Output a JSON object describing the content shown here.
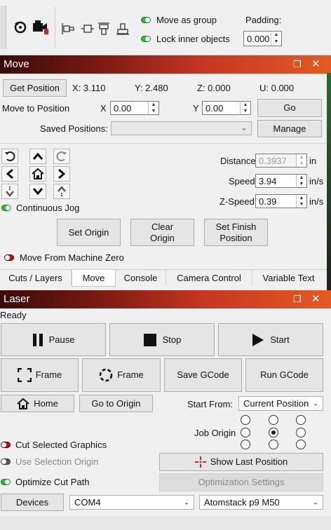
{
  "toolbar": {
    "move_as_group": "Move as group",
    "lock_inner_objects": "Lock inner objects",
    "padding_label": "Padding:",
    "padding_value": "0.000"
  },
  "move_panel": {
    "title": "Move",
    "get_position": "Get Position",
    "x_readout": "X: 3.110",
    "y_readout": "Y: 2.480",
    "z_readout": "Z: 0.000",
    "u_readout": "U: 0.000",
    "move_to_position": "Move to Position",
    "x_label": "X",
    "x_value": "0.00",
    "y_label": "Y",
    "y_value": "0.00",
    "go": "Go",
    "saved_positions_label": "Saved Positions:",
    "saved_positions_value": "",
    "manage": "Manage",
    "distance_label": "Distance",
    "distance_value": "0.3937",
    "distance_unit": "in",
    "speed_label": "Speed",
    "speed_value": "3.94",
    "speed_unit": "in/s",
    "zspeed_label": "Z-Speed",
    "zspeed_value": "0.39",
    "zspeed_unit": "in/s",
    "continuous_jog": "Continuous Jog",
    "set_origin": "Set Origin",
    "clear_origin": "Clear Origin",
    "set_finish_position": "Set Finish Position",
    "move_from_machine_zero": "Move From Machine Zero"
  },
  "tabs": [
    "Cuts / Layers",
    "Move",
    "Console",
    "Camera Control",
    "Variable Text"
  ],
  "active_tab": "Move",
  "laser_panel": {
    "title": "Laser",
    "status": "Ready",
    "pause": "Pause",
    "stop": "Stop",
    "start": "Start",
    "frame1": "Frame",
    "frame2": "Frame",
    "save_gcode": "Save GCode",
    "run_gcode": "Run GCode",
    "home": "Home",
    "go_to_origin": "Go to Origin",
    "start_from_label": "Start From:",
    "start_from_value": "Current Position",
    "job_origin_label": "Job Origin",
    "cut_selected_graphics": "Cut Selected Graphics",
    "use_selection_origin": "Use Selection Origin",
    "optimize_cut_path": "Optimize Cut Path",
    "show_last_position": "Show Last Position",
    "optimization_settings": "Optimization Settings",
    "devices": "Devices",
    "port_value": "COM4",
    "device_value": "Atomstack p9 M50"
  },
  "colors": {
    "title_gradient_start": "#3a0a0a",
    "title_gradient_end": "#e35a24",
    "toggle_on": "#2db83d",
    "toggle_off": "#b01818"
  }
}
